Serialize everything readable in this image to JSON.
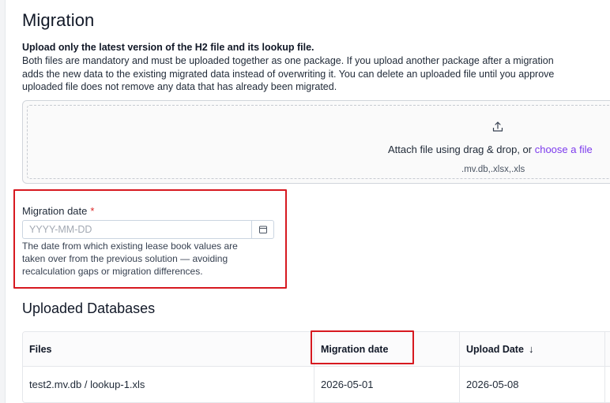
{
  "page": {
    "title": "Migration"
  },
  "intro": {
    "heading": "Upload only the latest version of the H2 file and its lookup file.",
    "lines": [
      "Both files are mandatory and must be uploaded together as one package. If you upload another package after a migration",
      "adds the new data to the existing migrated data instead of overwriting it. You can delete an uploaded file until you approve",
      "uploaded file does not remove any data that has already been migrated."
    ]
  },
  "dropzone": {
    "icon": "upload-icon",
    "attach_text": "Attach file using drag & drop, or ",
    "choose_link": "choose a file",
    "accepted_types": ".mv.db,.xlsx,.xls"
  },
  "migration_date_field": {
    "label": "Migration date",
    "required_marker": "*",
    "value": "",
    "placeholder": "YYYY-MM-DD",
    "icon": "calendar-icon",
    "helper_lines": [
      "The date from which existing lease book values are",
      "taken over from the previous solution — avoiding",
      "recalculation gaps or migration differences."
    ]
  },
  "uploaded_databases": {
    "title": "Uploaded Databases",
    "columns": {
      "files": "Files",
      "migration_date": "Migration date",
      "upload_date": "Upload Date",
      "upload_sort_icon": "↓"
    },
    "rows": [
      {
        "files": "test2.mv.db / lookup-1.xls",
        "migration_date": "2026-05-01",
        "upload_date": "2026-05-08"
      }
    ]
  },
  "colors": {
    "accent_link": "#7c3aed",
    "highlight": "#d71920",
    "required": "#dc2626"
  }
}
